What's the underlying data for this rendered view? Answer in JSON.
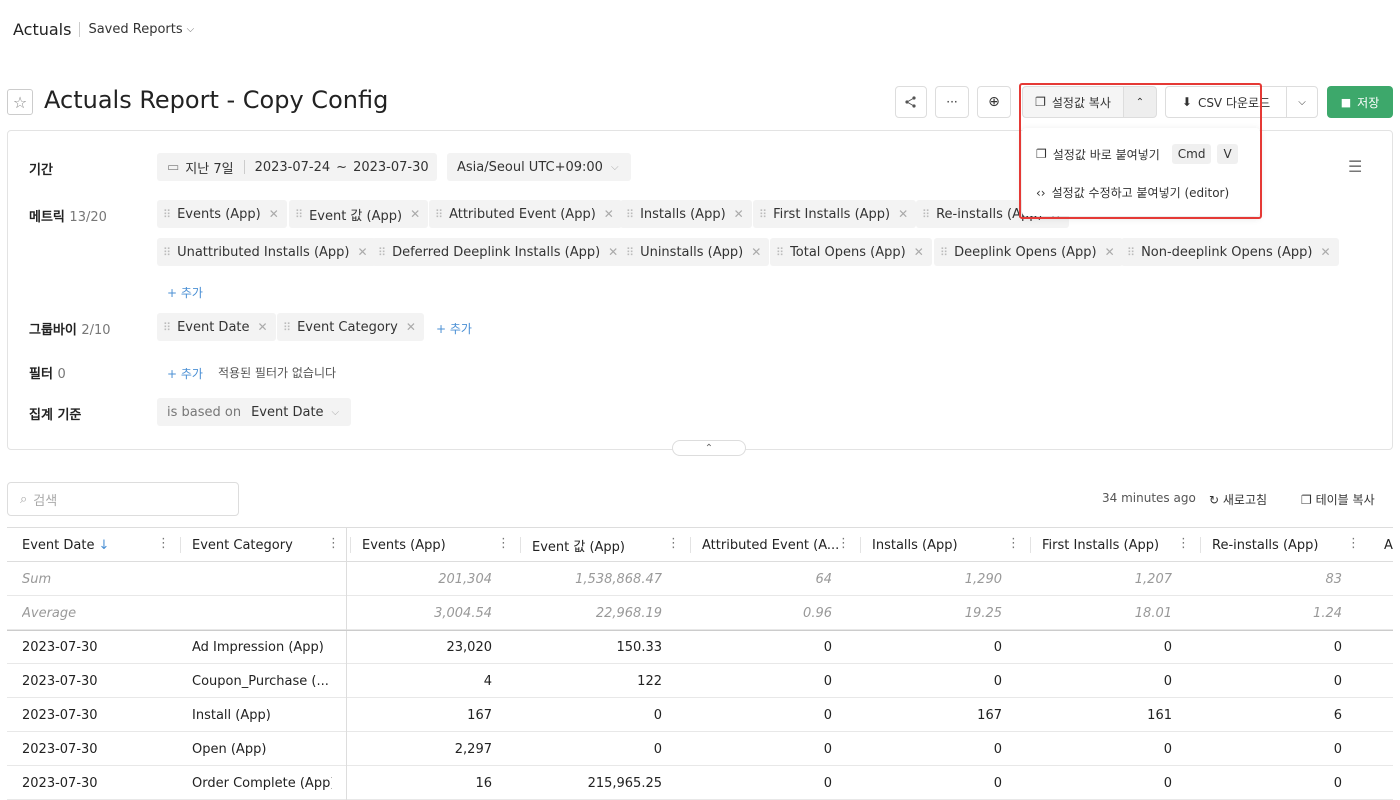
{
  "breadcrumb": {
    "root": "Actuals",
    "saved": "Saved Reports"
  },
  "page": {
    "title": "Actuals Report - Copy Config"
  },
  "toolbar": {
    "copy_config": "설정값 복사",
    "csv": "CSV 다운로드",
    "save": "저장"
  },
  "dropdown": {
    "paste_direct": "설정값 바로 붙여넣기",
    "kbd1": "Cmd",
    "kbd2": "V",
    "edit_paste": "설정값 수정하고 붙여넣기 (editor)"
  },
  "config": {
    "period": {
      "label": "기간",
      "preset": "지난 7일",
      "start": "2023-07-24",
      "tilde": "~",
      "end": "2023-07-30",
      "timezone": "Asia/Seoul UTC+09:00"
    },
    "metrics": {
      "label": "메트릭",
      "count": "13/20",
      "items": [
        "Events (App)",
        "Event 값 (App)",
        "Attributed Event (App)",
        "Installs (App)",
        "First Installs (App)",
        "Re-installs (App)",
        "Unattributed Installs (App)",
        "Deferred Deeplink Installs (App)",
        "Uninstalls (App)",
        "Total Opens (App)",
        "Deeplink Opens (App)",
        "Non-deeplink Opens (App)"
      ],
      "add": "+ 추가"
    },
    "groupby": {
      "label": "그룹바이",
      "count": "2/10",
      "items": [
        "Event Date",
        "Event Category"
      ],
      "add": "+ 추가"
    },
    "filter": {
      "label": "필터",
      "count": "0",
      "add": "+ 추가",
      "empty": "적용된 필터가 없습니다"
    },
    "aggregation": {
      "label": "집계 기준",
      "prefix": "is based on",
      "value": "Event Date"
    }
  },
  "search": {
    "placeholder": "검색"
  },
  "meta": {
    "updated": "34 minutes ago",
    "refresh": "새로고침",
    "copy_table": "테이블 복사"
  },
  "table": {
    "columns": [
      "Event Date",
      "Event Category",
      "Events (App)",
      "Event 값 (App)",
      "Attributed Event (A...",
      "Installs (App)",
      "First Installs (App)",
      "Re-installs (App)",
      "A"
    ],
    "sort_arrow": "↓",
    "sum": {
      "label": "Sum",
      "values": [
        "201,304",
        "1,538,868.47",
        "64",
        "1,290",
        "1,207",
        "83"
      ]
    },
    "average": {
      "label": "Average",
      "values": [
        "3,004.54",
        "22,968.19",
        "0.96",
        "19.25",
        "18.01",
        "1.24"
      ]
    },
    "rows": [
      {
        "date": "2023-07-30",
        "category": "Ad Impression (App)",
        "values": [
          "23,020",
          "150.33",
          "0",
          "0",
          "0",
          "0"
        ]
      },
      {
        "date": "2023-07-30",
        "category": "Coupon_Purchase (...",
        "values": [
          "4",
          "122",
          "0",
          "0",
          "0",
          "0"
        ]
      },
      {
        "date": "2023-07-30",
        "category": "Install (App)",
        "values": [
          "167",
          "0",
          "0",
          "167",
          "161",
          "6"
        ]
      },
      {
        "date": "2023-07-30",
        "category": "Open (App)",
        "values": [
          "2,297",
          "0",
          "0",
          "0",
          "0",
          "0"
        ]
      },
      {
        "date": "2023-07-30",
        "category": "Order Complete (App)",
        "values": [
          "16",
          "215,965.25",
          "0",
          "0",
          "0",
          "0"
        ]
      }
    ]
  },
  "colors": {
    "accent": "#3da86b",
    "link": "#4a8fd4",
    "highlight": "#e53935"
  }
}
